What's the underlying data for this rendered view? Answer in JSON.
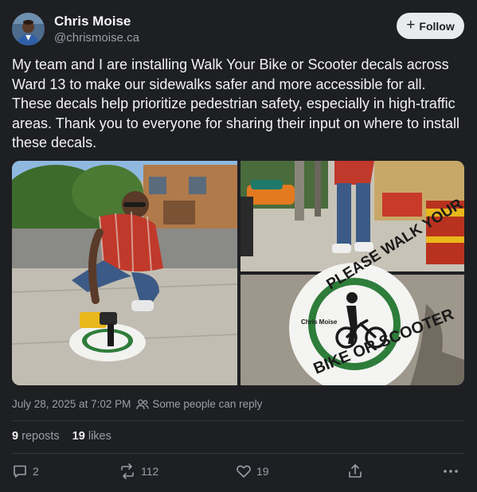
{
  "author": {
    "name": "Chris Moise",
    "handle": "@chrismoise.ca"
  },
  "follow_button": {
    "icon": "plus-icon",
    "label": "Follow"
  },
  "post": {
    "text": "My team and I are installing Walk Your Bike or Scooter decals across Ward 13 to make our sidewalks safer and more accessible for all. These decals help prioritize pedestrian safety, especially in high-traffic areas. Thank you to everyone for sharing their input on where to install these decals.",
    "timestamp": "July 28, 2025 at 7:02 PM",
    "reply_setting": "Some people can reply"
  },
  "media": {
    "decal_text_top": "PLEASE WALK YOUR",
    "decal_text_bottom": "BIKE OR SCOOTER",
    "decal_logo": "Chris Moise",
    "colors": {
      "decal_green": "#2e7d3a",
      "shirt_red": "#c0392b",
      "drill_yellow": "#e8b71a"
    }
  },
  "stats": {
    "reposts_count": "9",
    "reposts_label": "reposts",
    "likes_count": "19",
    "likes_label": "likes"
  },
  "actions": {
    "reply_count": "2",
    "repost_count": "112",
    "like_count": "19"
  },
  "colors": {
    "background": "#1e1f23",
    "text_primary": "#f2f2f2",
    "text_secondary": "#9aa0a8",
    "button_bg": "#e9eaec"
  }
}
